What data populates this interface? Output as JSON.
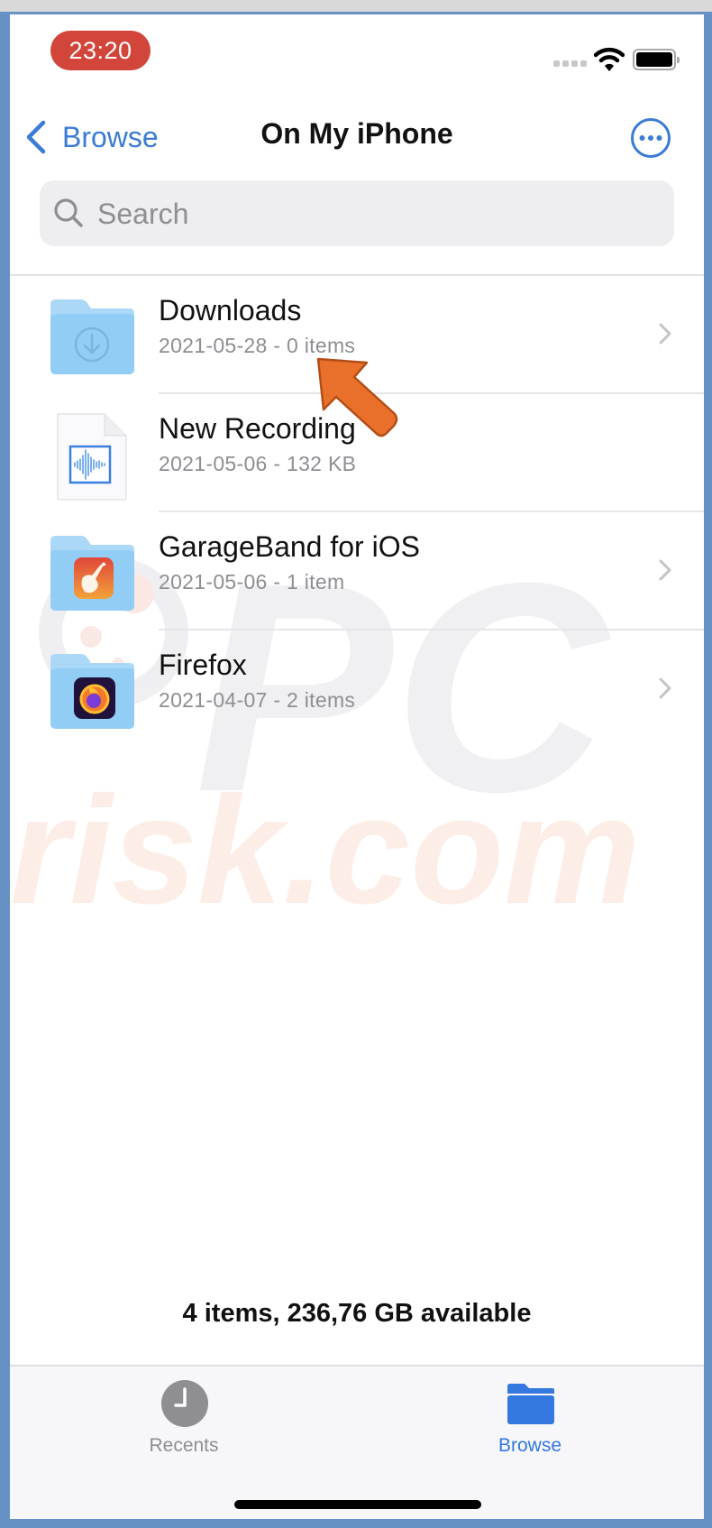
{
  "status_bar": {
    "time": "23:20",
    "icons": [
      "cellular-signal-icon",
      "wifi-icon",
      "battery-icon"
    ]
  },
  "nav": {
    "back_label": "Browse",
    "title": "On My iPhone",
    "more_icon": "ellipsis-circle-icon"
  },
  "search": {
    "placeholder": "Search",
    "value": ""
  },
  "files": [
    {
      "name": "Downloads",
      "meta": "2021-05-28 - 0 items",
      "kind": "folder",
      "icon": "downloads-folder-icon",
      "has_chevron": true
    },
    {
      "name": "New Recording",
      "meta": "2021-05-06 - 132 KB",
      "kind": "file",
      "icon": "audio-file-icon",
      "has_chevron": false
    },
    {
      "name": "GarageBand for iOS",
      "meta": "2021-05-06 - 1 item",
      "kind": "folder",
      "icon": "garageband-folder-icon",
      "has_chevron": true
    },
    {
      "name": "Firefox",
      "meta": "2021-04-07 - 2 items",
      "kind": "folder",
      "icon": "firefox-folder-icon",
      "has_chevron": true
    }
  ],
  "footer": {
    "summary": "4 items, 236,76 GB available"
  },
  "tabs": [
    {
      "label": "Recents",
      "icon": "clock-icon",
      "active": false
    },
    {
      "label": "Browse",
      "icon": "folder-icon",
      "active": true
    }
  ],
  "watermark": {
    "line1": "PC",
    "line2": "risk.com"
  },
  "colors": {
    "accent": "#3478e0",
    "time_pill": "#d2453a",
    "annotation_arrow": "#e8702a",
    "folder": "#91cdf5"
  }
}
